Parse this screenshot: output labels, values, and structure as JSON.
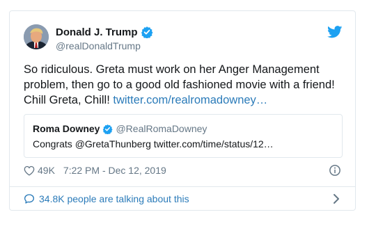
{
  "tweet": {
    "author_name": "Donald J. Trump",
    "author_handle": "@realDonaldTrump",
    "text": "So ridiculous. Greta must work on her Anger Management problem, then go to a good old fashioned movie with a friend! Chill Greta, Chill!",
    "link_text": "twitter.com/realromadowney…",
    "likes": "49K",
    "timestamp": "7:22 PM - Dec 12, 2019"
  },
  "quote": {
    "author_name": "Roma Downey",
    "author_handle": "@RealRomaDowney",
    "text": "Congrats @GretaThunberg twitter.com/time/status/12…"
  },
  "footer": {
    "talking_text": "34.8K people are talking about this"
  },
  "colors": {
    "twitter_blue": "#1da1f2",
    "link_blue": "#2b7bb9",
    "muted_gray": "#657786",
    "border": "#e1e8ed"
  },
  "icons": [
    "verified-badge-icon",
    "twitter-bird-icon",
    "heart-icon",
    "info-icon",
    "speech-bubble-icon",
    "chevron-right-icon"
  ]
}
